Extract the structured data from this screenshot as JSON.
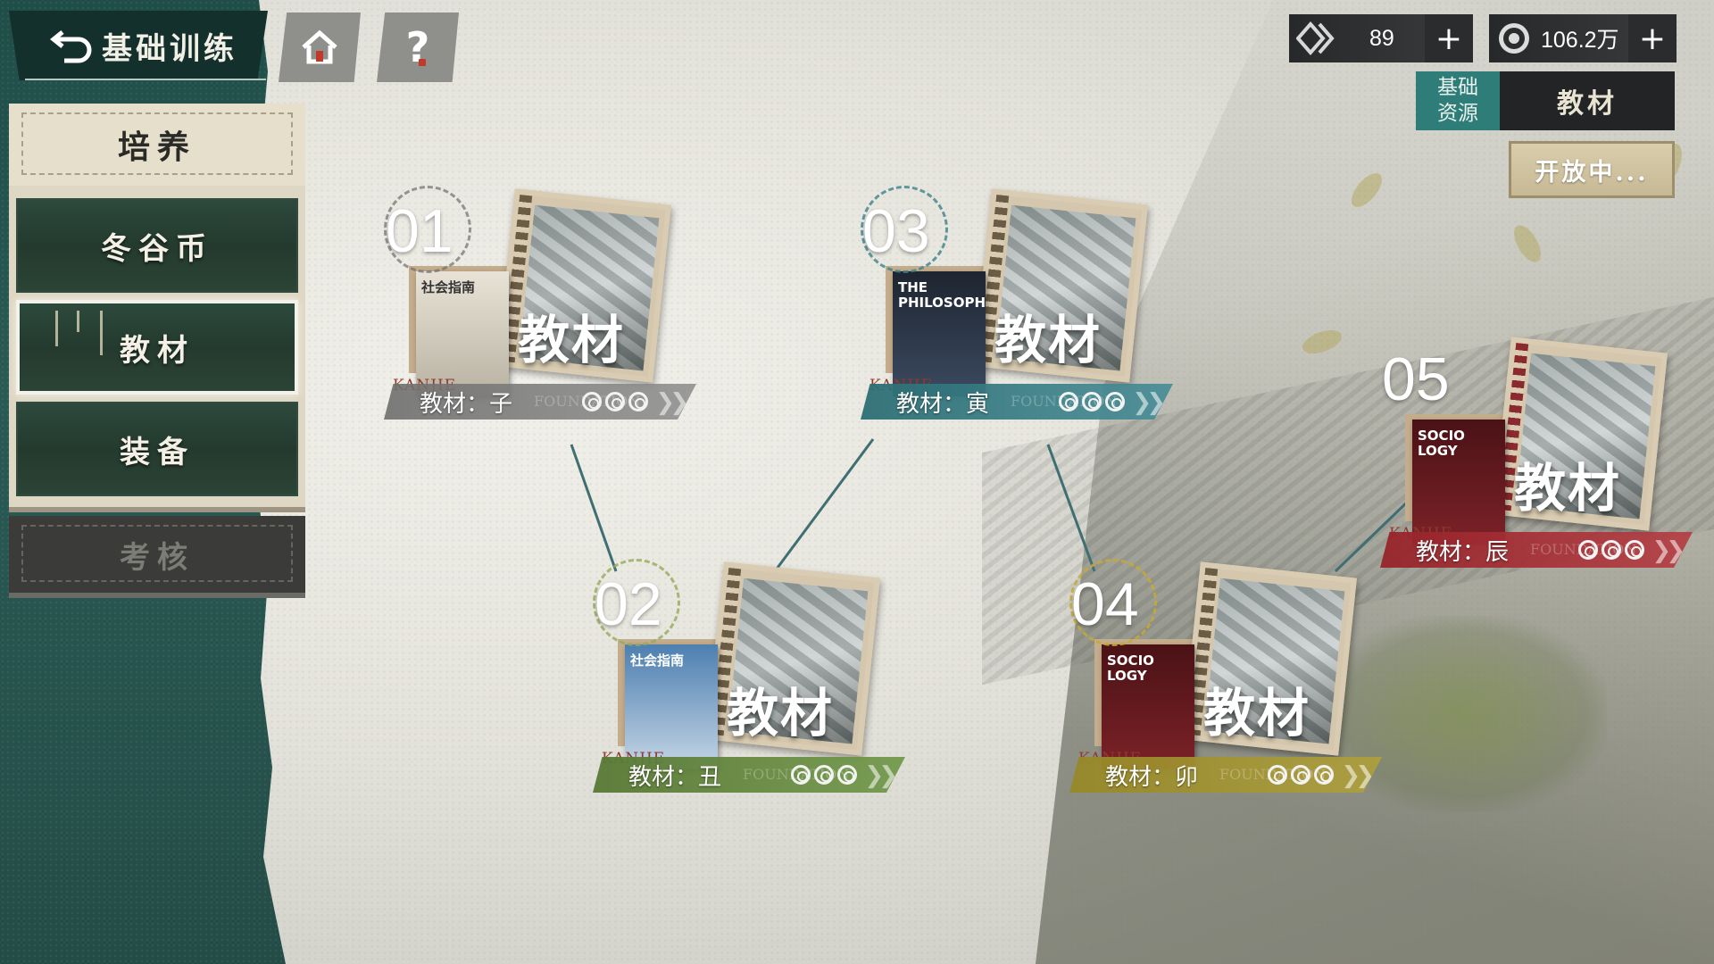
{
  "header": {
    "back_title": "基础训练",
    "home_icon": "home-icon",
    "help_label": "?"
  },
  "menu": {
    "group_title": "培养",
    "items": [
      {
        "label": "冬谷币",
        "selected": false
      },
      {
        "label": "教材",
        "selected": true
      },
      {
        "label": "装备",
        "selected": false
      }
    ],
    "assess_label": "考核"
  },
  "currencies": [
    {
      "icon": "stamina-crystal-icon",
      "value": "89",
      "add_label": "+"
    },
    {
      "icon": "coin-icon",
      "value": "106.2万",
      "add_label": "+"
    }
  ],
  "filter": {
    "left_label": "基础\n资源",
    "right_label": "教材",
    "open_status": "开放中..."
  },
  "stages": [
    {
      "number": "01",
      "cover_title": "教材",
      "name": "教材：子",
      "book_title": "社会指南",
      "color": "#8a8a8a",
      "stars": 3
    },
    {
      "number": "02",
      "cover_title": "教材",
      "name": "教材：丑",
      "book_title": "社会指南",
      "color": "#6e9646",
      "stars": 3
    },
    {
      "number": "03",
      "cover_title": "教材",
      "name": "教材：寅",
      "book_title": "THE PHILOSOPHY",
      "color": "#2c6e74",
      "stars": 3
    },
    {
      "number": "04",
      "cover_title": "教材",
      "name": "教材：卯",
      "book_title": "SOCIO LOGY",
      "color": "#a08c28",
      "stars": 3
    },
    {
      "number": "05",
      "cover_title": "教材",
      "name": "教材：辰",
      "book_title": "SOCIO LOGY",
      "color": "#96242a",
      "stars": 3
    }
  ],
  "book_brand": "KANJIE",
  "cover_watermark": "FOUNDATION",
  "colors": {
    "panel_teal": "#244c47",
    "accent_teal": "#2f7d78",
    "menu_cream": "#e6dfcc"
  }
}
